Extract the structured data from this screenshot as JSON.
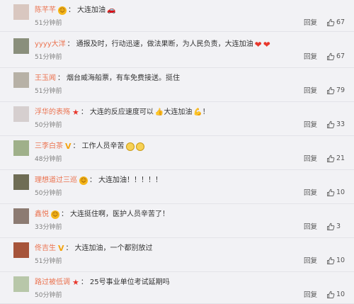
{
  "comments": [
    {
      "user": "陈芊芊",
      "badge": "crown",
      "text": "大连加油",
      "emojis": [
        {
          "name": "car-icon",
          "glyph": "🚗"
        }
      ],
      "time": "51分钟前",
      "reply": "回复",
      "likes": "67"
    },
    {
      "user": "yyyy大洋",
      "badge": "none",
      "text": "通报及时，行动迅速，做法果断，为人民负责，大连加油",
      "emojis": [
        {
          "name": "heart-icon",
          "glyph": "❤"
        },
        {
          "name": "heart-icon",
          "glyph": "❤"
        }
      ],
      "time": "51分钟前",
      "reply": "回复",
      "likes": "67"
    },
    {
      "user": "王玉闻",
      "badge": "none",
      "text": "烟台威海船票，有车免费接送。挺住",
      "emojis": [],
      "time": "51分钟前",
      "reply": "回复",
      "likes": "79"
    },
    {
      "user": "浮华的表殇",
      "badge": "star",
      "text": "大连的反应速度可以",
      "emojis": [
        {
          "name": "thumbs-up-icon",
          "glyph": "👍"
        }
      ],
      "text2": "大连加油",
      "emojis2": [
        {
          "name": "strong-arm-icon",
          "glyph": "💪"
        }
      ],
      "tail": "！",
      "time": "50分钟前",
      "reply": "回复",
      "likes": "33"
    },
    {
      "user": "三李白茶",
      "badge": "vip",
      "text": "工作人员辛苦",
      "emojis": [
        {
          "name": "smile-face-icon",
          "glyph": ""
        },
        {
          "name": "crying-face-icon",
          "glyph": ""
        }
      ],
      "time": "48分钟前",
      "reply": "回复",
      "likes": "21"
    },
    {
      "user": "理想道过三巡",
      "badge": "crown",
      "text": "大连加油！！！！！",
      "emojis": [],
      "time": "50分钟前",
      "reply": "回复",
      "likes": "10"
    },
    {
      "user": "鑫悦",
      "badge": "crown",
      "text": "大连挺住啊，医护人员辛苦了！",
      "emojis": [],
      "time": "33分钟前",
      "reply": "回复",
      "likes": "3"
    },
    {
      "user": "佟吉生",
      "badge": "vip",
      "text": "大连加油，一个都别放过",
      "emojis": [],
      "time": "51分钟前",
      "reply": "回复",
      "likes": "10"
    },
    {
      "user": "路过被低调",
      "badge": "star",
      "text": "25号事业单位考试延期吗",
      "emojis": [],
      "time": "50分钟前",
      "reply": "回复",
      "likes": "10"
    }
  ],
  "badge_glyphs": {
    "crown": "☺",
    "star": "★",
    "vip": "V"
  },
  "avatar_colors": [
    "#d9c7c0",
    "#8a8f7c",
    "#b7b1a6",
    "#d6cfcf",
    "#9fb08a",
    "#6f6d55",
    "#8c7b72",
    "#a6543a",
    "#b8c7a9"
  ],
  "colors": {
    "username": "#eb7350",
    "background": "#f2f2f5",
    "divider": "#e3e3e8"
  },
  "icons": {
    "like": "thumbs-up-outline-icon"
  }
}
